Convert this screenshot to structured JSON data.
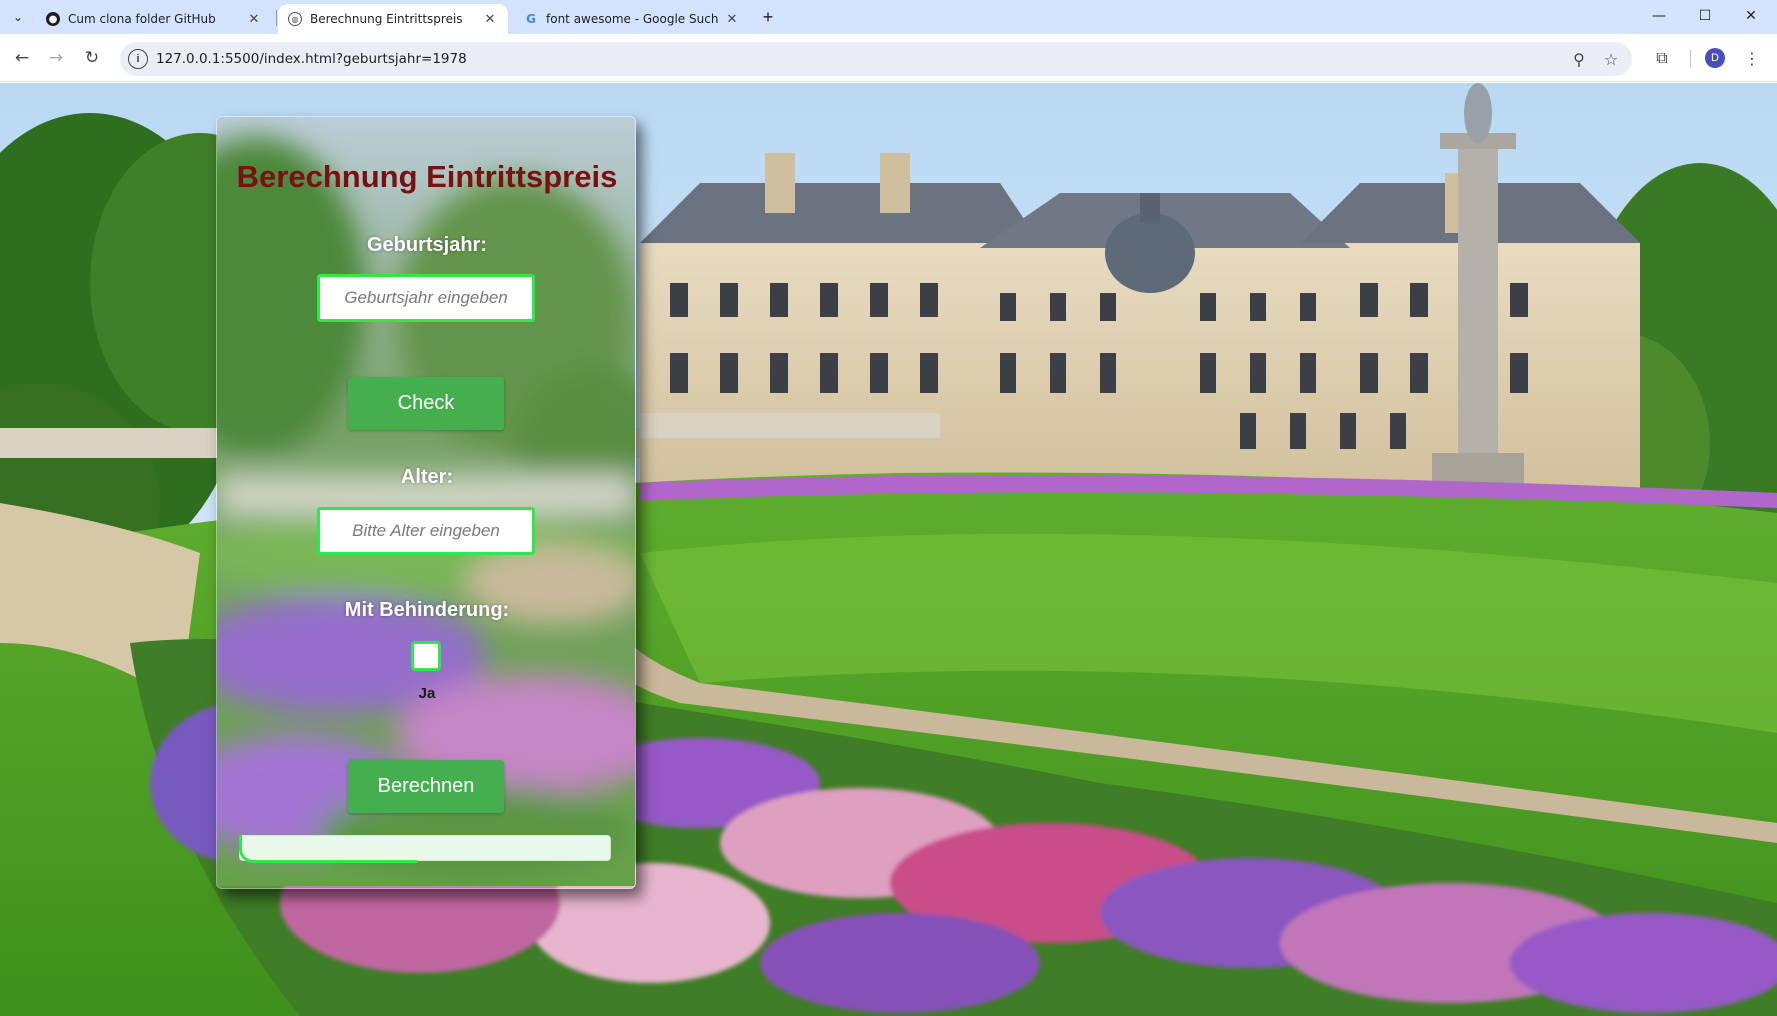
{
  "browser": {
    "tabs": [
      {
        "title": "Cum clona folder GitHub",
        "icon": "github-icon",
        "active": false
      },
      {
        "title": "Berechnung Eintrittspreis",
        "icon": "globe-icon",
        "active": true
      },
      {
        "title": "font awesome - Google Suche",
        "icon": "google-icon",
        "active": false
      }
    ],
    "url": "127.0.0.1:5500/index.html?geburtsjahr=1978",
    "profile_initial": "D"
  },
  "form": {
    "title": "Berechnung Eintrittspreis",
    "birth_year_label": "Geburtsjahr:",
    "birth_year_placeholder": "Geburtsjahr eingeben",
    "birth_year_value": "",
    "check_button": "Check",
    "age_label": "Alter:",
    "age_placeholder": "Bitte Alter eingeben",
    "age_value": "",
    "disability_label": "Mit Behinderung:",
    "disability_option": "Ja",
    "disability_checked": false,
    "calculate_button": "Berechnen",
    "result_text": ""
  },
  "colors": {
    "title": "#7a1010",
    "button": "#45ae4f",
    "input_border": "#2ee84c",
    "tabbar": "#d3e3fd"
  }
}
